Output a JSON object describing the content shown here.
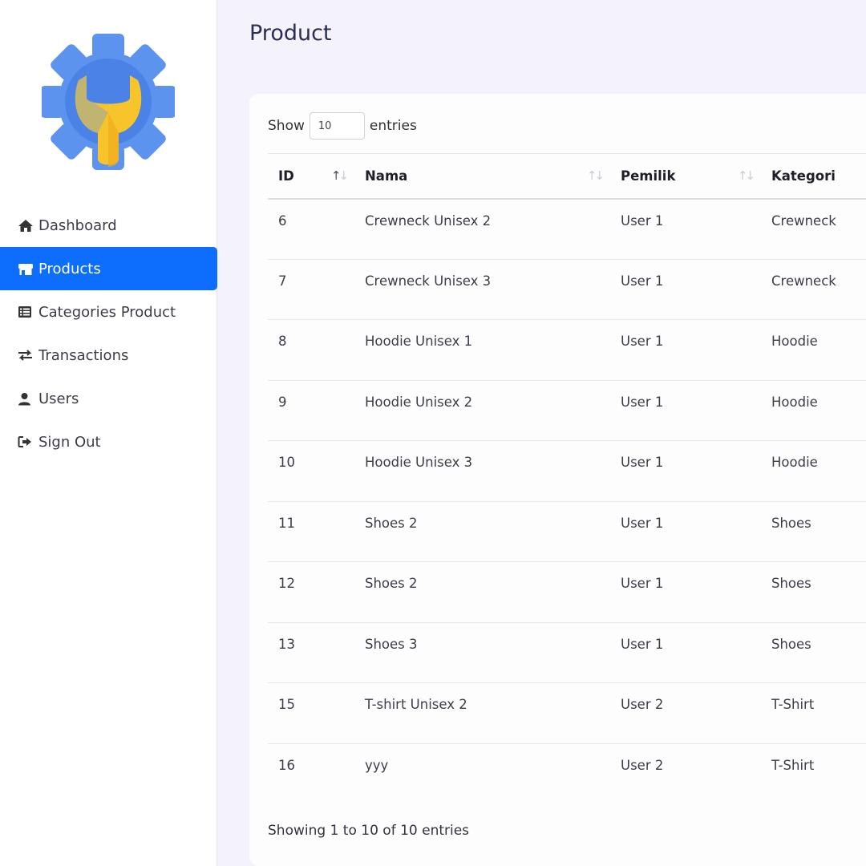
{
  "sidebar": {
    "items": [
      {
        "label": "Dashboard",
        "icon": "home-icon",
        "active": false
      },
      {
        "label": "Products",
        "icon": "store-icon",
        "active": true
      },
      {
        "label": "Categories Product",
        "icon": "list-icon",
        "active": false
      },
      {
        "label": "Transactions",
        "icon": "exchange-icon",
        "active": false
      },
      {
        "label": "Users",
        "icon": "user-icon",
        "active": false
      },
      {
        "label": "Sign Out",
        "icon": "sign-out-icon",
        "active": false
      }
    ],
    "active_color": "#0d6efd"
  },
  "page": {
    "title": "Product"
  },
  "table": {
    "length_prefix": "Show",
    "length_value": "10",
    "length_suffix": "entries",
    "columns": [
      "ID",
      "Nama",
      "Pemilik",
      "Kategori"
    ],
    "rows": [
      [
        "6",
        "Crewneck Unisex 2",
        "User 1",
        "Crewneck"
      ],
      [
        "7",
        "Crewneck Unisex 3",
        "User 1",
        "Crewneck"
      ],
      [
        "8",
        "Hoodie Unisex 1",
        "User 1",
        "Hoodie"
      ],
      [
        "9",
        "Hoodie Unisex 2",
        "User 1",
        "Hoodie"
      ],
      [
        "10",
        "Hoodie Unisex 3",
        "User 1",
        "Hoodie"
      ],
      [
        "11",
        "Shoes 2",
        "User 1",
        "Shoes"
      ],
      [
        "12",
        "Shoes 2",
        "User 1",
        "Shoes"
      ],
      [
        "13",
        "Shoes 3",
        "User 1",
        "Shoes"
      ],
      [
        "15",
        "T-shirt Unisex 2",
        "User 2",
        "T-Shirt"
      ],
      [
        "16",
        "yyy",
        "User 2",
        "T-Shirt"
      ]
    ],
    "info": "Showing 1 to 10 of 10 entries"
  }
}
